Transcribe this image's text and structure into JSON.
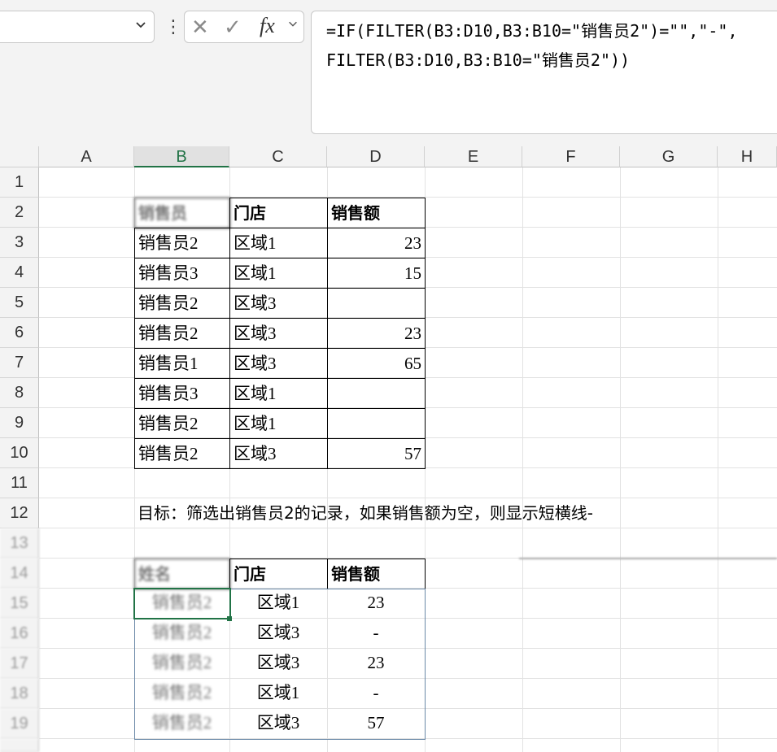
{
  "formula_bar": {
    "name_box": "",
    "cancel_glyph": "✕",
    "enter_glyph": "✓",
    "fx_glyph": "fx",
    "formula_line1": "=IF(FILTER(B3:D10,B3:B10=\"销售员2\")=\"\",\"-\",",
    "formula_line2": "FILTER(B3:D10,B3:B10=\"销售员2\"))"
  },
  "columns": [
    "A",
    "B",
    "C",
    "D",
    "E",
    "F",
    "G",
    "H"
  ],
  "rows": [
    "1",
    "2",
    "3",
    "4",
    "5",
    "6",
    "7",
    "8",
    "9",
    "10",
    "11",
    "12"
  ],
  "table1": {
    "headers": [
      "",
      "门店",
      "销售额"
    ],
    "rows": [
      [
        "销售员2",
        "区域1",
        "23"
      ],
      [
        "销售员3",
        "区域1",
        "15"
      ],
      [
        "销售员2",
        "区域3",
        ""
      ],
      [
        "销售员2",
        "区域3",
        "23"
      ],
      [
        "销售员1",
        "区域3",
        "65"
      ],
      [
        "销售员3",
        "区域1",
        ""
      ],
      [
        "销售员2",
        "区域1",
        ""
      ],
      [
        "销售员2",
        "区域3",
        "57"
      ]
    ]
  },
  "note": "目标：筛选出销售员2的记录，如果销售额为空，则显示短横线-",
  "table2": {
    "headers": [
      "",
      "门店",
      "销售额"
    ],
    "rows": [
      [
        "区域1",
        "23"
      ],
      [
        "区域3",
        "-"
      ],
      [
        "区域3",
        "23"
      ],
      [
        "区域1",
        "-"
      ],
      [
        "区域3",
        "57"
      ]
    ]
  }
}
